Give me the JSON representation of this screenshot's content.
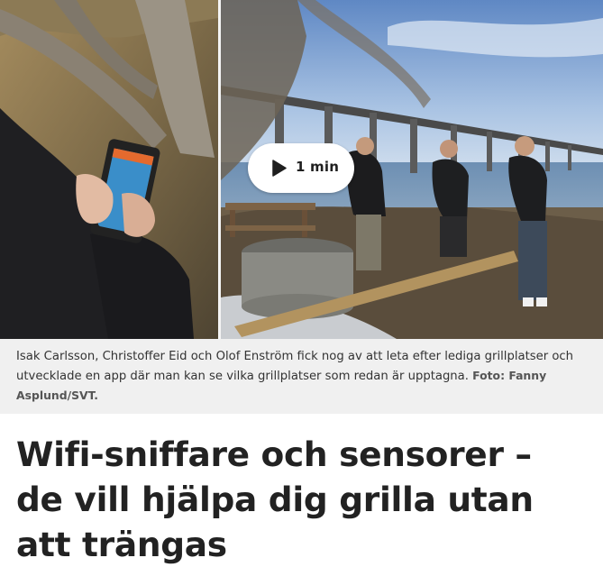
{
  "video": {
    "duration_label": "1 min",
    "play_icon": "play-icon"
  },
  "caption": {
    "text": "Isak Carlsson, Christoffer Eid och Olof Enström fick nog av att leta efter lediga grillplatser och utvecklade en app där man kan se vilka grillplatser som redan är upptagna.",
    "credit": "Foto: Fanny Asplund/SVT."
  },
  "article": {
    "headline": "Wifi-sniffare och sensorer – de vill hjälpa dig grilla utan att trängas"
  },
  "colors": {
    "caption_background": "#f0f0f0",
    "headline_text": "#222222",
    "play_pill_background": "#ffffff"
  }
}
